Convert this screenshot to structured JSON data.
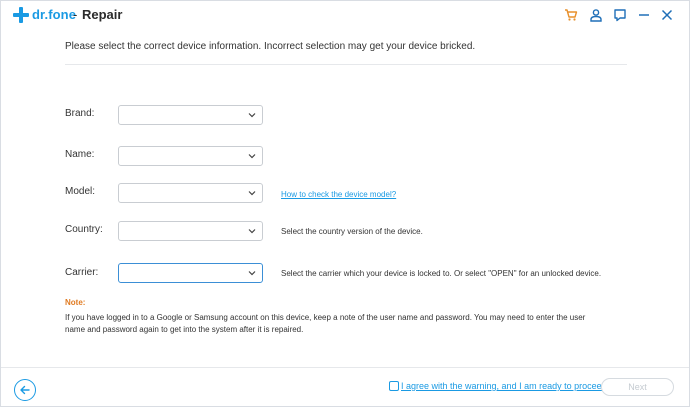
{
  "app": {
    "brand": "dr.fone",
    "separator": "-",
    "title": "Repair"
  },
  "titlebar_icons": [
    "cart-icon",
    "user-icon",
    "feedback-icon",
    "minimize-icon",
    "close-icon"
  ],
  "message": "Please select the correct device information. Incorrect selection may get your device bricked.",
  "form": {
    "brand": {
      "label": "Brand:",
      "value": ""
    },
    "name": {
      "label": "Name:",
      "value": ""
    },
    "model": {
      "label": "Model:",
      "value": "",
      "help_link": "How to check the device model?"
    },
    "country": {
      "label": "Country:",
      "value": "",
      "hint": "Select the country version of the device."
    },
    "carrier": {
      "label": "Carrier:",
      "value": "",
      "hint": "Select the carrier which your device is locked to. Or select \"OPEN\" for an unlocked device."
    }
  },
  "note": {
    "title": "Note:",
    "text": "If you have logged in to a Google or Samsung account on this device, keep a note of the user name and password. You may need to enter the user name and password again to get into the system after it is repaired."
  },
  "footer": {
    "agree_checked": false,
    "agree_text": "I agree with the warning, and I am ready to proceed.",
    "next_label": "Next"
  },
  "colors": {
    "accent": "#1a9ae3",
    "cart": "#e8902c",
    "note": "#e07b22",
    "disabled": "#c5cbd1"
  }
}
